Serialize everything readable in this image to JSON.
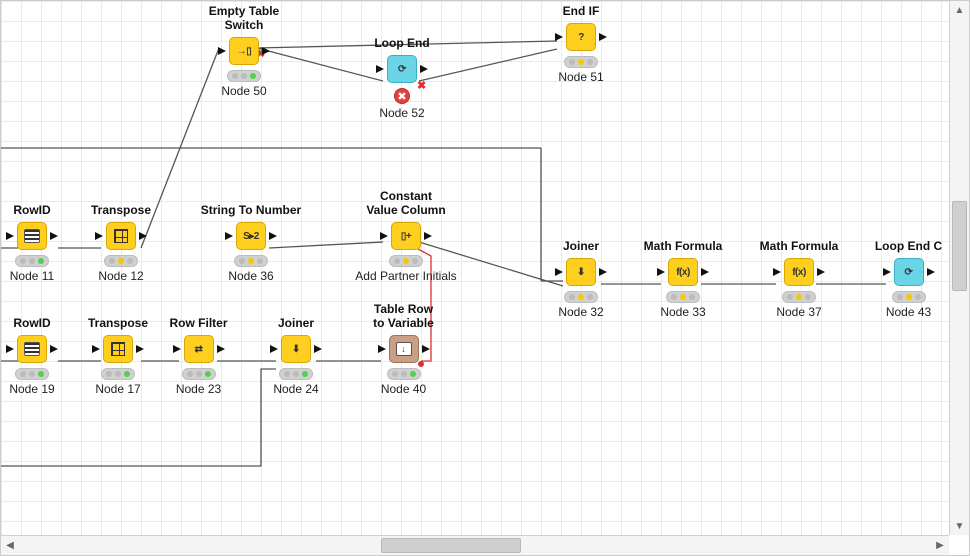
{
  "nodes": {
    "n50": {
      "title": "Empty Table Switch",
      "label": "Node 50"
    },
    "n51": {
      "title": "End IF",
      "label": "Node 51"
    },
    "n52": {
      "title": "Loop End",
      "label": "Node 52"
    },
    "n11": {
      "title": "RowID",
      "label": "Node 11"
    },
    "n12": {
      "title": "Transpose",
      "label": "Node 12"
    },
    "n36": {
      "title": "String To Number",
      "label": "Node 36"
    },
    "cvc": {
      "title": "Constant\nValue Column",
      "label": "Add Partner Initials"
    },
    "n32": {
      "title": "Joiner",
      "label": "Node 32"
    },
    "n33": {
      "title": "Math Formula",
      "label": "Node 33"
    },
    "n37": {
      "title": "Math Formula",
      "label": "Node 37"
    },
    "n43": {
      "title": "Loop End",
      "label": "Node 43",
      "suffix": "C"
    },
    "n19": {
      "title": "RowID",
      "label": "Node 19"
    },
    "n17": {
      "title": "Transpose",
      "label": "Node 17"
    },
    "n23": {
      "title": "Row Filter",
      "label": "Node 23"
    },
    "n24": {
      "title": "Joiner",
      "label": "Node 24"
    },
    "n40": {
      "title": "Table Row\nto Variable",
      "label": "Node 40"
    }
  },
  "icons": {
    "rowid": "≡",
    "string2num": "S▸2",
    "cvc": "▯+",
    "joiner": "⬇",
    "math": "f(x)",
    "loopend": "⟳",
    "endif": "?",
    "switch": "→▯",
    "filter": "⇄",
    "table2var": "⬚↓"
  }
}
